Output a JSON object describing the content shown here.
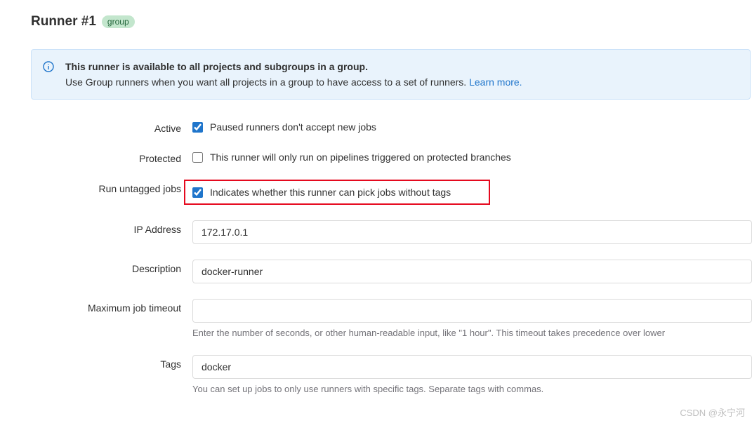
{
  "header": {
    "title": "Runner #1",
    "badge": "group"
  },
  "banner": {
    "title": "This runner is available to all projects and subgroups in a group.",
    "description": "Use Group runners when you want all projects in a group to have access to a set of runners. ",
    "link_text": "Learn more."
  },
  "fields": {
    "active": {
      "label": "Active",
      "checkbox_label": "Paused runners don't accept new jobs",
      "checked": true
    },
    "protected": {
      "label": "Protected",
      "checkbox_label": "This runner will only run on pipelines triggered on protected branches",
      "checked": false
    },
    "untagged": {
      "label": "Run untagged jobs",
      "checkbox_label": "Indicates whether this runner can pick jobs without tags",
      "checked": true
    },
    "ip": {
      "label": "IP Address",
      "value": "172.17.0.1"
    },
    "description": {
      "label": "Description",
      "value": "docker-runner"
    },
    "timeout": {
      "label": "Maximum job timeout",
      "value": "",
      "help": "Enter the number of seconds, or other human-readable input, like \"1 hour\". This timeout takes precedence over lower"
    },
    "tags": {
      "label": "Tags",
      "value": "docker",
      "help": "You can set up jobs to only use runners with specific tags. Separate tags with commas."
    }
  },
  "watermark": "CSDN @永宁河"
}
